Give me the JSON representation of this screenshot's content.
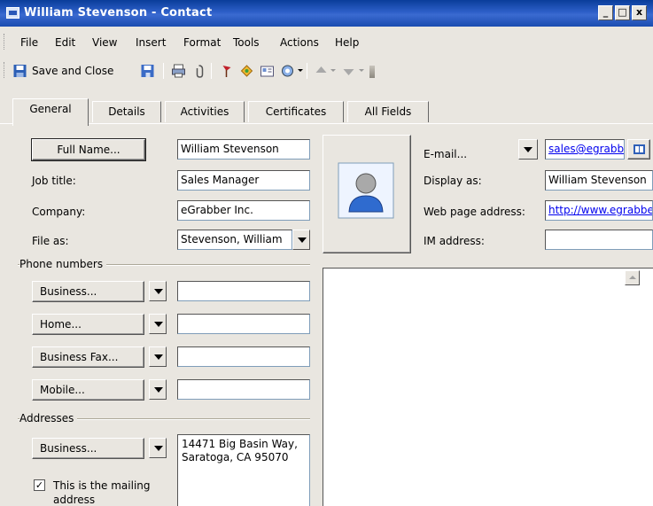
{
  "window": {
    "title": "William Stevenson - Contact",
    "controls": {
      "minimize": "_",
      "maximize": "□",
      "close": "x"
    }
  },
  "menubar": {
    "items": [
      "File",
      "Edit",
      "View",
      "Insert",
      "Format",
      "Tools",
      "Actions",
      "Help"
    ]
  },
  "toolbar": {
    "save_close_label": "Save and Close",
    "icons": [
      "save-close-icon",
      "save-icon",
      "print-icon",
      "attach-icon",
      "flag-icon",
      "categories-icon",
      "address-card-icon",
      "new-item-icon",
      "previous-item-icon",
      "next-item-icon"
    ]
  },
  "tabs": [
    {
      "label": "General",
      "active": true
    },
    {
      "label": "Details",
      "active": false
    },
    {
      "label": "Activities",
      "active": false
    },
    {
      "label": "Certificates",
      "active": false
    },
    {
      "label": "All Fields",
      "active": false
    }
  ],
  "form": {
    "full_name_button": "Full Name...",
    "full_name": "William Stevenson",
    "job_title_label": "Job title:",
    "job_title": "Sales Manager",
    "company_label": "Company:",
    "company": "eGrabber Inc.",
    "file_as_label": "File as:",
    "file_as": "Stevenson, William",
    "phone_group": "Phone numbers",
    "phones": [
      {
        "label": "Business...",
        "value": ""
      },
      {
        "label": "Home...",
        "value": ""
      },
      {
        "label": "Business Fax...",
        "value": ""
      },
      {
        "label": "Mobile...",
        "value": ""
      }
    ],
    "address_group": "Addresses",
    "address_button": "Business...",
    "address_line1": "14471 Big Basin Way,",
    "address_line2": "Saratoga, CA  95070",
    "mailing_checkbox_line1": "This is the mailing",
    "mailing_checkbox_line2": "address",
    "mailing_checked": true
  },
  "right": {
    "email_button": "E-mail...",
    "email": "sales@egrabber.com",
    "display_as_label": "Display as:",
    "display_as": "William Stevenson",
    "web_label": "Web page address:",
    "web": "http://www.egrabber.com",
    "im_label": "IM address:",
    "im": ""
  },
  "colors": {
    "title_bar": "#0a3d9a",
    "window_bg": "#e9e6e0",
    "link": "#0000ee"
  }
}
